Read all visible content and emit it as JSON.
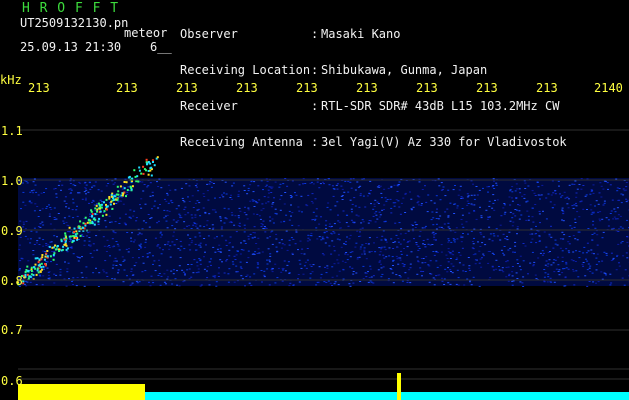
{
  "header": {
    "brand": "H R O F F T",
    "file_name": "UT2509132130.pn",
    "meteor_label": "meteor",
    "date_time": "25.09.13 21:30    6__"
  },
  "info": [
    {
      "key": "Observer",
      "sep": ":",
      "value": "Masaki Kano"
    },
    {
      "key": "Receiving Location",
      "sep": ":",
      "value": "Shibukawa, Gunma, Japan"
    },
    {
      "key": "Receiver",
      "sep": ":",
      "value": "RTL-SDR SDR# 43dB L15 103.2MHz CW"
    },
    {
      "key": "Receiving Antenna",
      "sep": ":",
      "value": "3el Yagi(V) Az 330 for Vladivostok"
    }
  ],
  "axis": {
    "y_unit": "kHz",
    "x_ticks": [
      "213",
      "213",
      "213",
      "213",
      "213",
      "213",
      "213",
      "213",
      "213",
      "2140"
    ],
    "y_ticks": [
      "1.1",
      "1.0",
      "0.9",
      "0.8",
      "0.7",
      "0.6"
    ]
  },
  "colors": {
    "background": "#000000",
    "text": "#f2f2f2",
    "brand": "#3ddc3d",
    "axis": "#ffff40",
    "waterfall_bg": "#1020c0",
    "trace": "#00ffff",
    "trace_high": "#ffff00"
  }
}
